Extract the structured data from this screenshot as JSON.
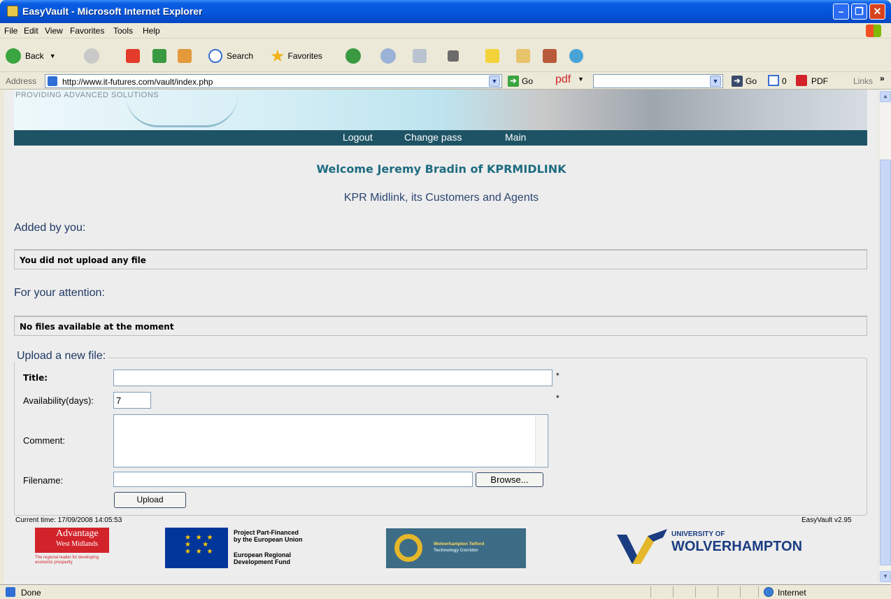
{
  "window": {
    "title": "EasyVault - Microsoft Internet Explorer"
  },
  "menu": [
    "File",
    "Edit",
    "View",
    "Favorites",
    "Tools",
    "Help"
  ],
  "toolbar": {
    "back": "Back",
    "search": "Search",
    "favorites": "Favorites"
  },
  "address": {
    "label": "Address",
    "url": "http://www.it-futures.com/vault/index.php",
    "go": "Go",
    "pdf_label": "pdf",
    "go2": "Go",
    "count": "0",
    "pdf_button": "PDF",
    "links": "Links"
  },
  "banner": {
    "tagline": "PROVIDING ADVANCED SOLUTIONS"
  },
  "nav": {
    "logout": "Logout",
    "change_pass": "Change pass",
    "main": "Main"
  },
  "welcome": "Welcome Jeremy Bradin of KPRMIDLINK",
  "company": "KPR Midlink, its Customers and Agents",
  "added": {
    "heading": "Added by you:",
    "message": "You did not upload any file"
  },
  "attention": {
    "heading": "For your attention:",
    "message": "No files available at the moment"
  },
  "upload": {
    "legend": "Upload a new file:",
    "title_label": "Title:",
    "title_value": "",
    "availability_label": "Availability(days):",
    "availability_value": "7",
    "comment_label": "Comment:",
    "filename_label": "Filename:",
    "browse": "Browse...",
    "submit": "Upload",
    "required_mark": "*"
  },
  "footer": {
    "current_time": "Current time: 17/09/2008 14:05:53",
    "version": "EasyVault v2.95",
    "advantage": {
      "line1": "Advantage",
      "line2": "West Midlands",
      "tagline": "The regional leader for developing economic prosperity"
    },
    "eu": {
      "line1": "Project Part-Financed",
      "line2": "by the European Union",
      "line3": "European Regional",
      "line4": "Development Fund"
    },
    "wolverhampton_telford": {
      "line1": "Wolverhampton Telford",
      "line2": "Technology Corridor"
    },
    "university": {
      "line1": "UNIVERSITY OF",
      "line2": "WOLVERHAMPTON"
    }
  },
  "status": {
    "text": "Done",
    "zone": "Internet"
  }
}
